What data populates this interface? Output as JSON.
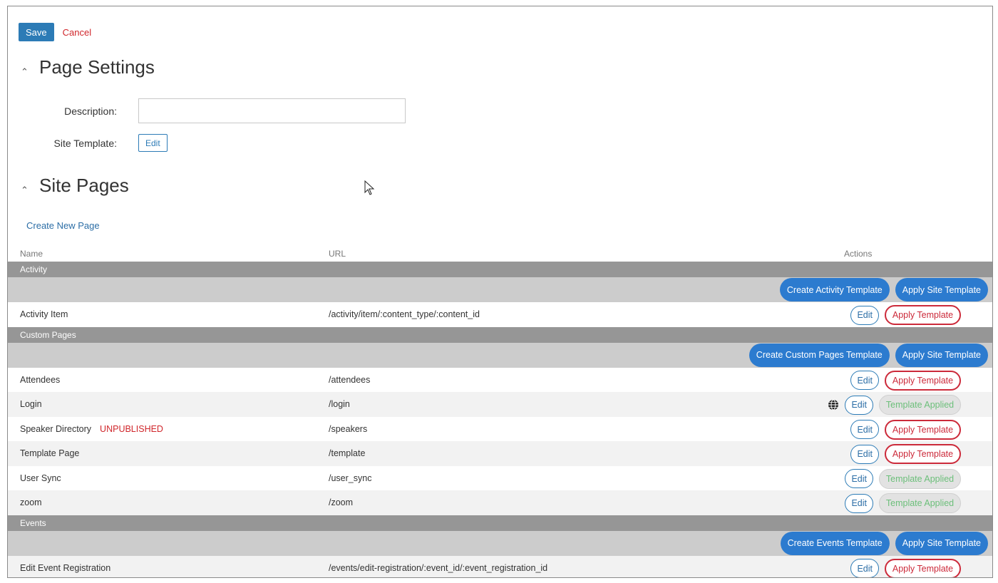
{
  "toolbar": {
    "save_label": "Save",
    "cancel_label": "Cancel"
  },
  "page_settings": {
    "title": "Page Settings",
    "description_label": "Description:",
    "description_value": "",
    "site_template_label": "Site Template:",
    "site_template_edit_label": "Edit"
  },
  "site_pages": {
    "title": "Site Pages",
    "create_new_page_label": "Create New Page",
    "columns": {
      "name": "Name",
      "url": "URL",
      "actions": "Actions"
    },
    "groups": [
      {
        "name": "Activity",
        "create_template_label": "Create Activity Template",
        "apply_site_template_label": "Apply Site Template",
        "rows": [
          {
            "name": "Activity Item",
            "url": "/activity/item/:content_type/:content_id",
            "edit": "Edit",
            "action": "Apply Template"
          }
        ]
      },
      {
        "name": "Custom Pages",
        "create_template_label": "Create Custom Pages Template",
        "apply_site_template_label": "Apply Site Template",
        "rows": [
          {
            "name": "Attendees",
            "url": "/attendees",
            "edit": "Edit",
            "action": "Apply Template"
          },
          {
            "name": "Login",
            "url": "/login",
            "edit": "Edit",
            "action": "Template Applied"
          },
          {
            "name": "Speaker Directory",
            "badge": "UNPUBLISHED",
            "url": "/speakers",
            "edit": "Edit",
            "action": "Apply Template"
          },
          {
            "name": "Template Page",
            "url": "/template",
            "edit": "Edit",
            "action": "Apply Template"
          },
          {
            "name": "User Sync",
            "url": "/user_sync",
            "edit": "Edit",
            "action": "Template Applied"
          },
          {
            "name": "zoom",
            "url": "/zoom",
            "edit": "Edit",
            "action": "Template Applied"
          }
        ]
      },
      {
        "name": "Events",
        "create_template_label": "Create Events Template",
        "apply_site_template_label": "Apply Site Template",
        "rows": [
          {
            "name": "Edit Event Registration",
            "url": "/events/edit-registration/:event_id/:event_registration_id",
            "edit": "Edit",
            "action": "Apply Template"
          }
        ]
      }
    ]
  },
  "colors": {
    "primary": "#2c7bb6",
    "pill_blue": "#2c7bcf",
    "danger": "#cc2a3a",
    "applied_text": "#6cbf7a",
    "group_header": "#969696",
    "template_row": "#cccccc"
  },
  "icons": {
    "collapse": "chevron-up-icon",
    "globe": "globe-icon",
    "cursor": "mouse-pointer-icon"
  }
}
